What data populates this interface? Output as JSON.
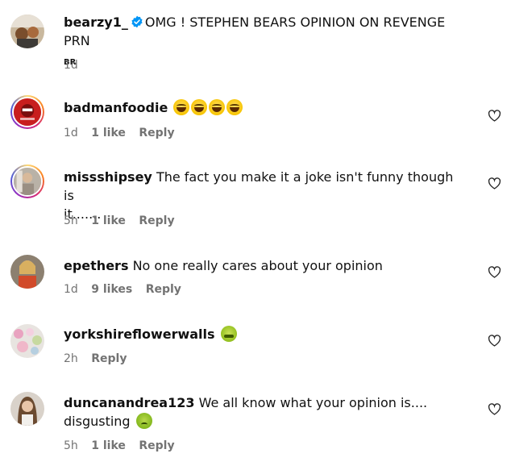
{
  "post": {
    "username": "bearzy1_",
    "caption": "OMG ! STEPHEN BEARS OPINION ON REVENGE PRN",
    "subtext": "BR",
    "time": "1d"
  },
  "comments": [
    {
      "username": "badmanfoodie",
      "text": "",
      "time": "1d",
      "likes": "1 like",
      "reply": "Reply",
      "emoji": [
        "laugh",
        "laugh",
        "laugh",
        "laugh"
      ]
    },
    {
      "username": "missshipsey",
      "text": "The fact you make it a joke isn't funny though is",
      "text2": "it.......",
      "time": "5h",
      "likes": "1 like",
      "reply": "Reply"
    },
    {
      "username": "epethers",
      "text": "No one really cares about your opinion",
      "time": "1d",
      "likes": "9 likes",
      "reply": "Reply"
    },
    {
      "username": "yorkshireflowerwalls",
      "text": "",
      "time": "2h",
      "reply": "Reply",
      "emoji": [
        "sick"
      ]
    },
    {
      "username": "duncanandrea123",
      "text": "We all know what your opinion is....",
      "text2": "disgusting",
      "time": "5h",
      "likes": "1 like",
      "reply": "Reply",
      "emoji": [
        "green"
      ]
    }
  ],
  "colors": {
    "verified": "#0095f6",
    "meta": "#737373",
    "text": "#111111"
  },
  "icons": {
    "like": "heart-icon",
    "verified": "verified-badge-icon"
  }
}
